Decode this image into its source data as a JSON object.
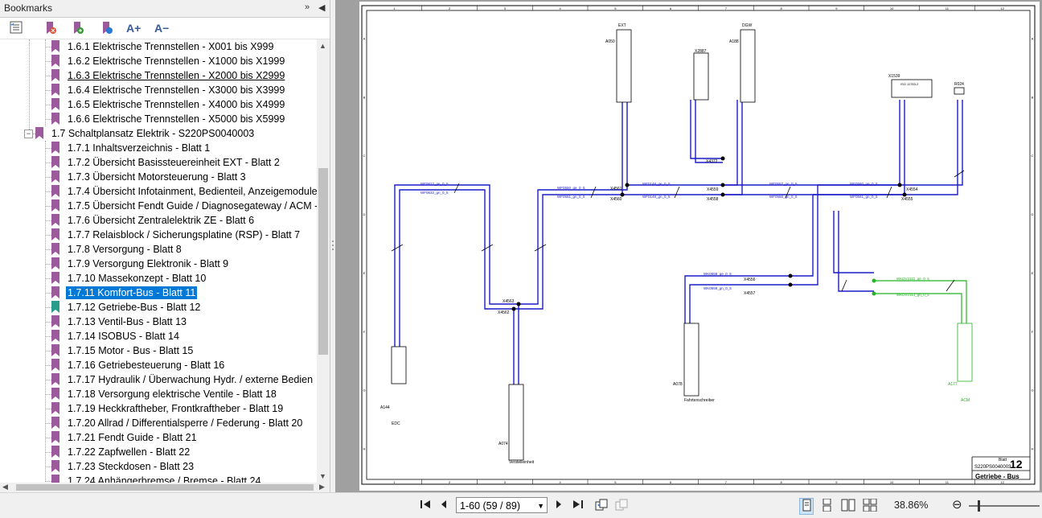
{
  "panel": {
    "title": "Bookmarks",
    "header_buttons": [
      "»",
      "◀"
    ]
  },
  "toolbar": {
    "icons": [
      "options-icon",
      "delete-bookmark-icon",
      "new-bookmark-icon",
      "bookmark-properties-icon",
      "increase-text-icon",
      "decrease-text-icon"
    ],
    "increase_text": "A+",
    "decrease_text": "A−"
  },
  "tree": {
    "items": [
      {
        "label": "1.6.1 Elektrische Trennstellen - X001 bis X999"
      },
      {
        "label": "1.6.2 Elektrische Trennstellen - X1000 bis X1999"
      },
      {
        "label": "1.6.3 Elektrische Trennstellen - X2000 bis X2999"
      },
      {
        "label": "1.6.4 Elektrische Trennstellen - X3000 bis X3999"
      },
      {
        "label": "1.6.5 Elektrische Trennstellen - X4000 bis X4999"
      },
      {
        "label": "1.6.6 Elektrische Trennstellen - X5000 bis X5999"
      },
      {
        "label": "1.7 Schaltplansatz Elektrik - S220PS0040003"
      },
      {
        "label": "1.7.1 Inhaltsverzeichnis - Blatt 1"
      },
      {
        "label": "1.7.2 Übersicht Basissteuereinheit EXT - Blatt 2"
      },
      {
        "label": "1.7.3 Übersicht Motorsteuerung - Blatt 3"
      },
      {
        "label": "1.7.4 Übersicht Infotainment, Bedienteil, Anzeigemodule"
      },
      {
        "label": "1.7.5 Übersicht Fendt Guide / Diagnosegateway / ACM -"
      },
      {
        "label": "1.7.6 Übersicht Zentralelektrik ZE - Blatt 6"
      },
      {
        "label": "1.7.7 Relaisblock / Sicherungsplatine (RSP) - Blatt 7"
      },
      {
        "label": "1.7.8 Versorgung - Blatt 8"
      },
      {
        "label": "1.7.9 Versorgung Elektronik - Blatt 9"
      },
      {
        "label": "1.7.10 Massekonzept - Blatt 10"
      },
      {
        "label": "1.7.11 Komfort-Bus - Blatt 11"
      },
      {
        "label": "1.7.12 Getriebe-Bus - Blatt 12"
      },
      {
        "label": "1.7.13 Ventil-Bus - Blatt 13"
      },
      {
        "label": "1.7.14 ISOBUS - Blatt 14"
      },
      {
        "label": "1.7.15 Motor - Bus - Blatt 15"
      },
      {
        "label": "1.7.16 Getriebesteuerung - Blatt 16"
      },
      {
        "label": "1.7.17 Hydraulik / Überwachung Hydr. / externe Bedien"
      },
      {
        "label": "1.7.18 Versorgung elektrische Ventile - Blatt 18"
      },
      {
        "label": "1.7.19 Heckkraftheber, Frontkraftheber - Blatt 19"
      },
      {
        "label": "1.7.20 Allrad / Differentialsperre / Federung - Blatt 20"
      },
      {
        "label": "1.7.21 Fendt Guide - Blatt 21"
      },
      {
        "label": "1.7.22 Zapfwellen - Blatt 22"
      },
      {
        "label": "1.7.23 Steckdosen - Blatt 23"
      },
      {
        "label": "1.7.24 Anhängerbremse / Bremse - Blatt 24"
      }
    ],
    "selected_index": 17,
    "underlined_index": 2,
    "current_page_index": 18,
    "expander_glyph": "−"
  },
  "schematic": {
    "title_label": "Blatt",
    "sheet_number": "12",
    "drawing_id": "S220PS0040003",
    "sheet_title": "Getriebe - Bus",
    "columns": [
      "1",
      "2",
      "3",
      "4",
      "5",
      "6",
      "7",
      "8",
      "9",
      "10",
      "11",
      "12"
    ],
    "rows": [
      "A",
      "B",
      "C",
      "D",
      "E",
      "F",
      "G",
      "H"
    ],
    "components": [
      {
        "id": "A050",
        "sub": "EXT"
      },
      {
        "id": "X2887"
      },
      {
        "id": "A188",
        "sub": "DGW"
      },
      {
        "id": "X1539",
        "sub": "ISO 11783-2"
      },
      {
        "id": "R024"
      },
      {
        "id": "A144",
        "sub": "EDC"
      },
      {
        "id": "A074",
        "sub": "Verstelleinheit"
      },
      {
        "id": "A078",
        "sub": "Fahrtenschreiber"
      },
      {
        "id": "A177",
        "sub": "ACM"
      }
    ],
    "connectors": [
      "X4563",
      "X4562",
      "X4561",
      "X4560",
      "X4559",
      "X4558",
      "X4554",
      "X4555",
      "X4556",
      "X4557",
      "X4372"
    ],
    "wires": [
      "WF0612_ge_0_5",
      "WF0632_gn_0_5",
      "WF0550_ge_0_5",
      "WF0551_gn_0_5",
      "WF0148_ge_0_5",
      "WF0149_gn_0_5",
      "WF0557_ge_0_5",
      "WF0556_gn_0_5",
      "WF0560_ge_0_5",
      "WF0561_gn_0_5",
      "WK0558_ge_0_5",
      "WK0559_gn_0_5",
      "WKDV2112_ge_0_5",
      "WKDV2113_gn_0_5"
    ]
  },
  "statusbar": {
    "page_display": "1-60 (59 / 89)",
    "zoom_level": "38.86%",
    "zoom_minus": "⊖"
  },
  "colors": {
    "selection": "#0078d7",
    "bookmark": "#9c5a9c",
    "bookmark_current": "#2a9c8c",
    "wire_blue": "#1c1cc8",
    "wire_green": "#22b422"
  }
}
